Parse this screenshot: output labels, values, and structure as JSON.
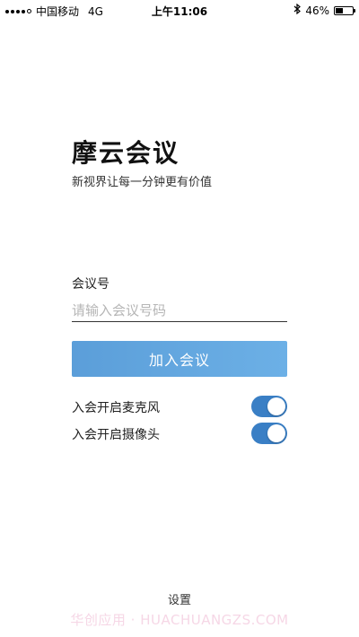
{
  "status_bar": {
    "carrier": "中国移动",
    "network": "4G",
    "time": "上午11:06",
    "battery_text": "46%",
    "battery_level": 0.46
  },
  "brand": {
    "title": "摩云会议",
    "subtitle": "新视界让每一分钟更有价值"
  },
  "form": {
    "meeting_label": "会议号",
    "meeting_placeholder": "请输入会议号码",
    "meeting_value": "",
    "join_label": "加入会议",
    "accent_color": "#5b9ed9"
  },
  "toggles": {
    "mic_label": "入会开启麦克风",
    "mic_on": true,
    "camera_label": "入会开启摄像头",
    "camera_on": true,
    "on_color": "#3a7fc5"
  },
  "footer": {
    "settings_label": "设置",
    "watermark": "华创应用 · HUACHUANGZS.COM"
  }
}
